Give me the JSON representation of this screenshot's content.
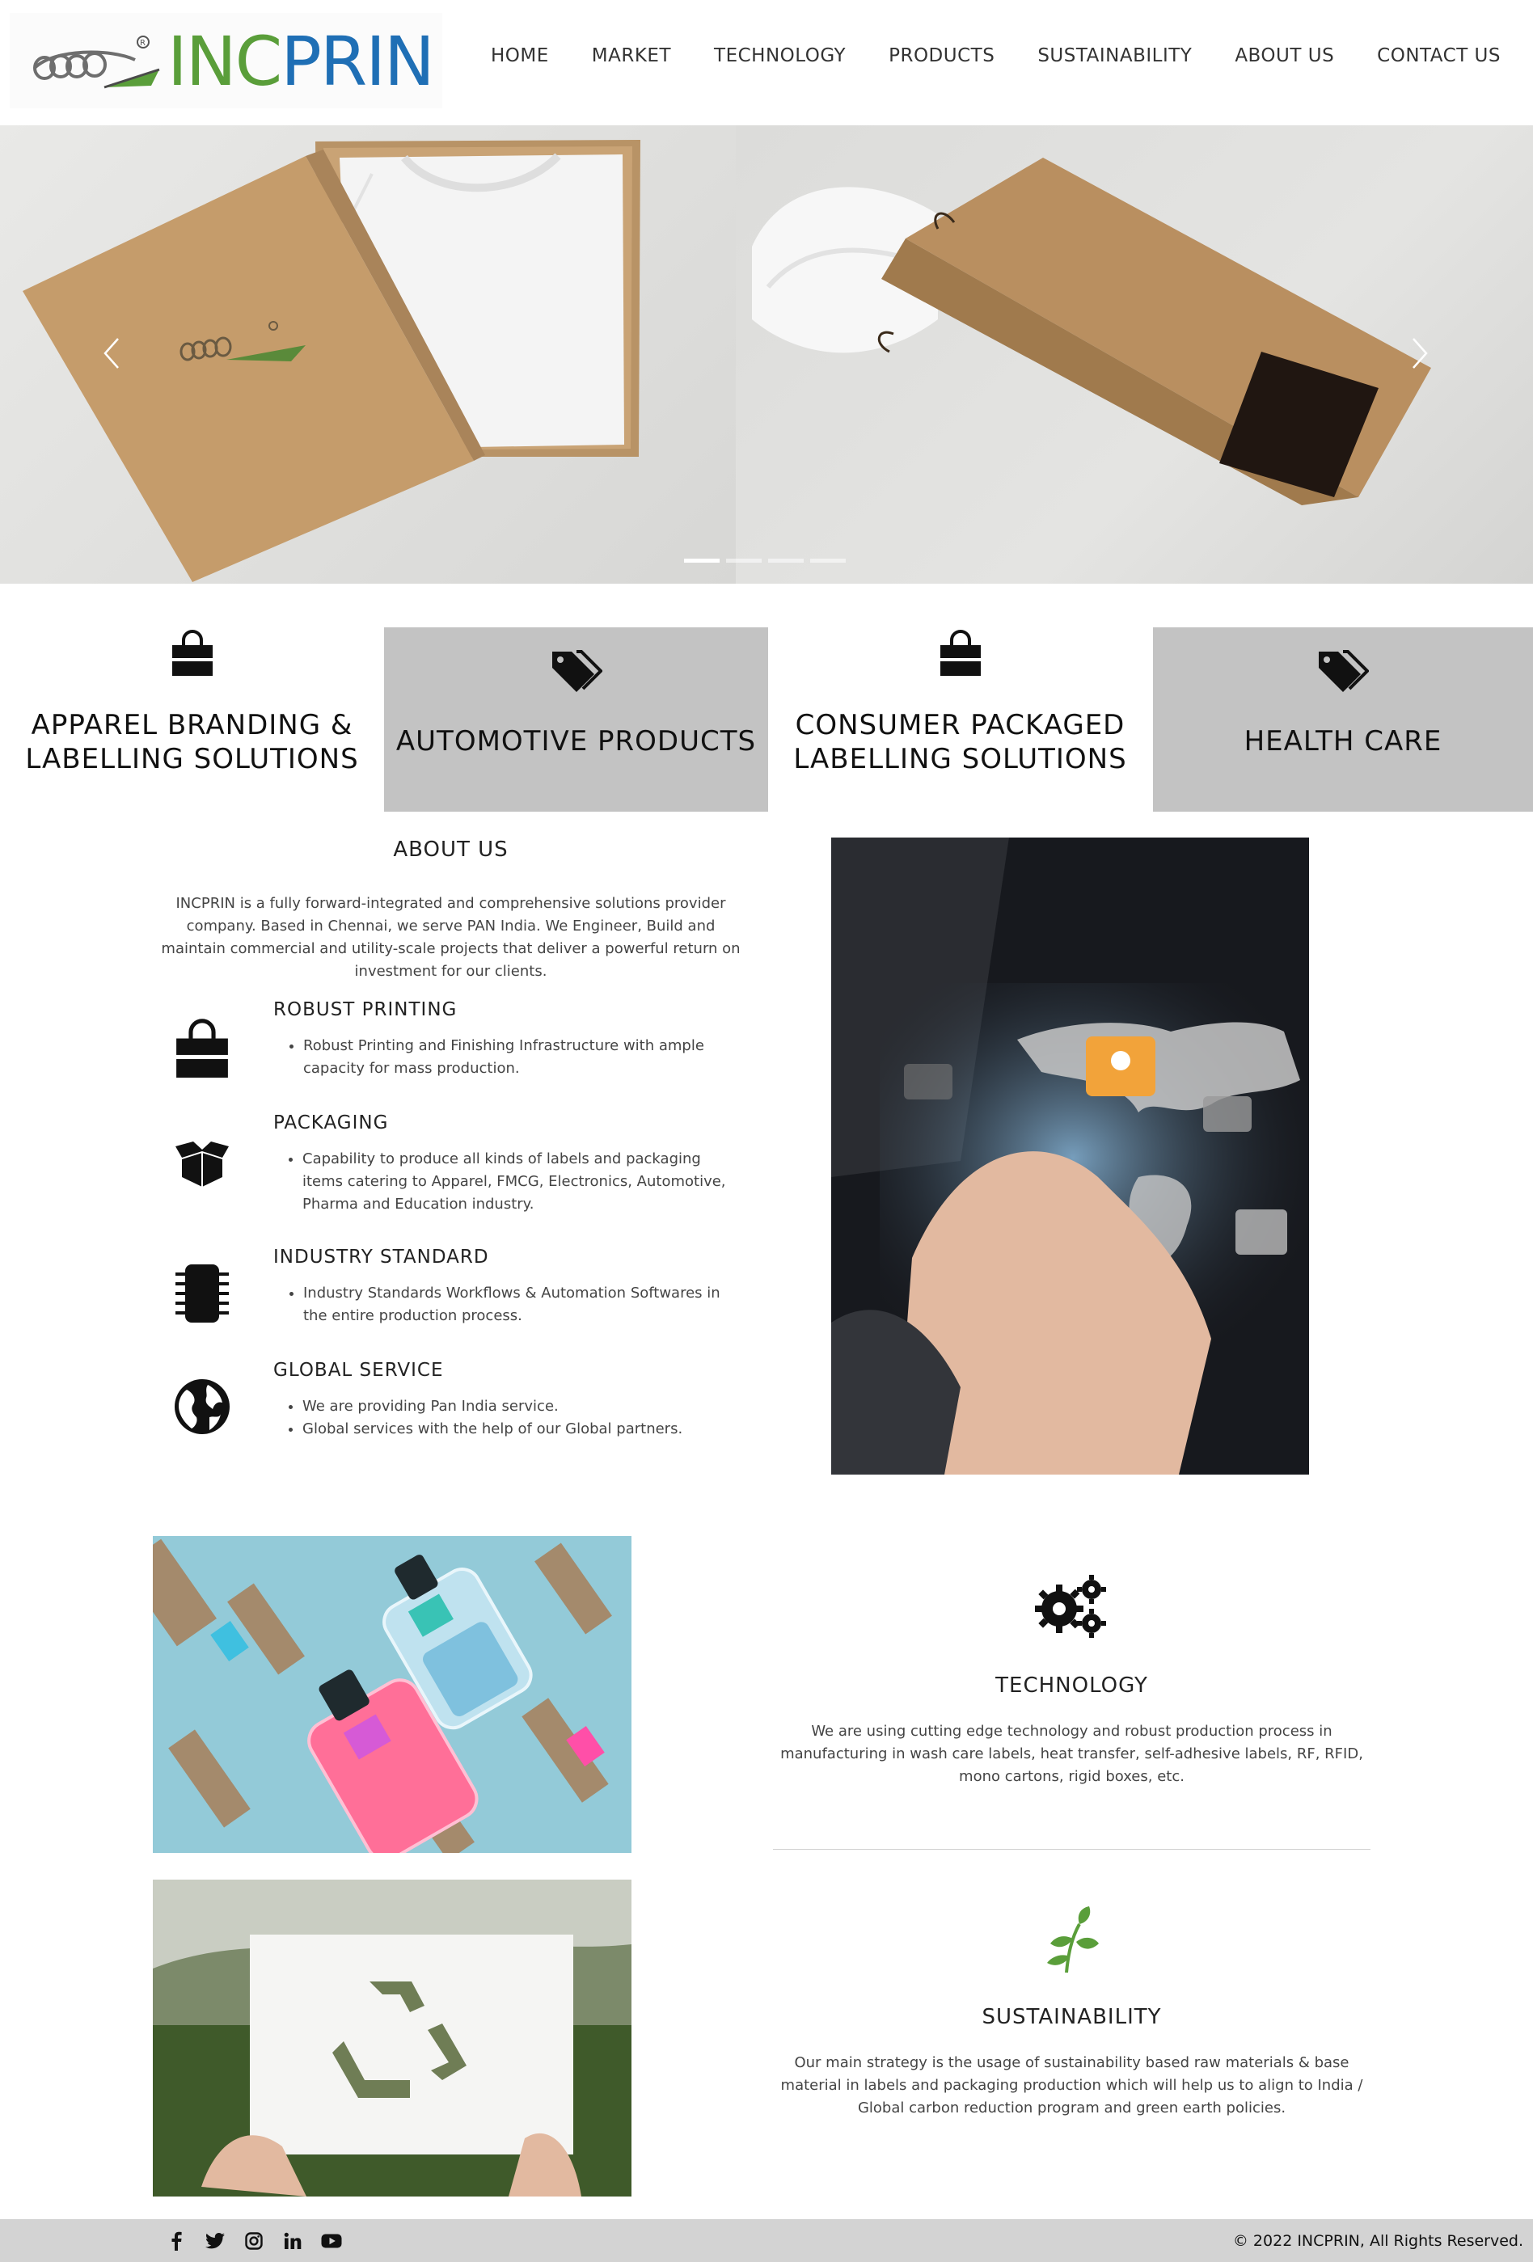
{
  "brand": {
    "part1": "INC",
    "part2": "PRIN",
    "colors": {
      "green": "#5a9e3a",
      "blue": "#1f6fb5"
    }
  },
  "nav": [
    {
      "label": "HOME"
    },
    {
      "label": "MARKET"
    },
    {
      "label": "TECHNOLOGY"
    },
    {
      "label": "PRODUCTS"
    },
    {
      "label": "SUSTAINABILITY"
    },
    {
      "label": "ABOUT US"
    },
    {
      "label": "CONTACT US"
    }
  ],
  "hero": {
    "prev_icon": "chevron-left-icon",
    "next_icon": "chevron-right-icon",
    "slide_count": 4,
    "active_slide": 1
  },
  "tiles": [
    {
      "line1": "APPAREL BRANDING &",
      "line2": "LABELLING SOLUTIONS",
      "icon": "shopping-bag-icon"
    },
    {
      "line1": "AUTOMOTIVE PRODUCTS",
      "line2": "",
      "icon": "tags-icon"
    },
    {
      "line1": "CONSUMER PACKAGED",
      "line2": "LABELLING SOLUTIONS",
      "icon": "shopping-bag-icon"
    },
    {
      "line1": "HEALTH CARE",
      "line2": "",
      "icon": "tags-icon"
    }
  ],
  "about": {
    "title": "ABOUT US",
    "description": "INCPRIN is a fully forward-integrated and comprehensive solutions provider company. Based in Chennai, we serve PAN India. We Engineer, Build and maintain commercial and utility-scale projects that deliver a powerful return on investment for our clients.",
    "features": [
      {
        "title": "ROBUST PRINTING",
        "icon": "shopping-bag-icon",
        "items": [
          "Robust Printing and Finishing Infrastructure with ample capacity for mass production."
        ]
      },
      {
        "title": "PACKAGING",
        "icon": "open-box-icon",
        "items": [
          "Capability to produce all kinds of labels and packaging items catering to Apparel, FMCG, Electronics, Automotive, Pharma and Education industry."
        ]
      },
      {
        "title": "INDUSTRY STANDARD",
        "icon": "microchip-icon",
        "items": [
          "Industry Standards Workflows & Automation Softwares in the entire production process."
        ]
      },
      {
        "title": "GLOBAL SERVICE",
        "icon": "globe-icon",
        "items": [
          "We are providing Pan India service.",
          "Global services with the help of our Global partners."
        ]
      }
    ]
  },
  "technology": {
    "title": "TECHNOLOGY",
    "icon": "gears-icon",
    "text": "We are using cutting edge technology and robust production process in manufacturing in wash care labels, heat transfer, self-adhesive labels, RF, RFID, mono cartons, rigid boxes, etc."
  },
  "sustainability": {
    "title": "SUSTAINABILITY",
    "icon": "leaf-icon",
    "text": "Our main strategy is the usage of sustainability based raw materials & base material in labels and packaging production which will help us to align to India / Global carbon reduction program and green earth policies."
  },
  "footer": {
    "socials": [
      "facebook-icon",
      "twitter-icon",
      "instagram-icon",
      "linkedin-icon",
      "youtube-icon"
    ],
    "copyright": "© 2022 INCPRIN, All Rights Reserved."
  }
}
